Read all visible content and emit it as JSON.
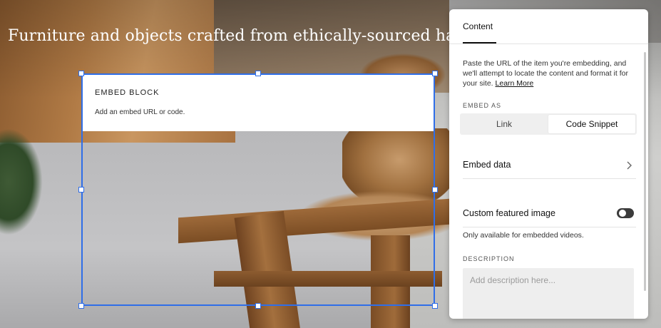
{
  "page": {
    "headline": "Furniture and objects crafted from ethically-sourced hard"
  },
  "embed_block": {
    "title": "EMBED BLOCK",
    "subtitle": "Add an embed URL or code."
  },
  "panel": {
    "tab_label": "Content",
    "intro_text": "Paste the URL of the item you're embedding, and we'll attempt to locate the content and format it for your site.",
    "learn_more": "Learn More",
    "embed_as_label": "EMBED AS",
    "embed_as_options": [
      "Link",
      "Code Snippet"
    ],
    "embed_as_selected": "Code Snippet",
    "embed_data_label": "Embed data",
    "custom_image_label": "Custom featured image",
    "custom_image_enabled": false,
    "custom_image_note": "Only available for embedded videos.",
    "description_label": "DESCRIPTION",
    "description_placeholder": "Add description here..."
  },
  "colors": {
    "selection": "#2f6ee8",
    "toggle_track": "#3b3b3b",
    "panel_bg": "#ffffff",
    "segment_bg": "#efefef"
  },
  "icons": {
    "embed_data_chevron": "chevron-right-icon"
  }
}
